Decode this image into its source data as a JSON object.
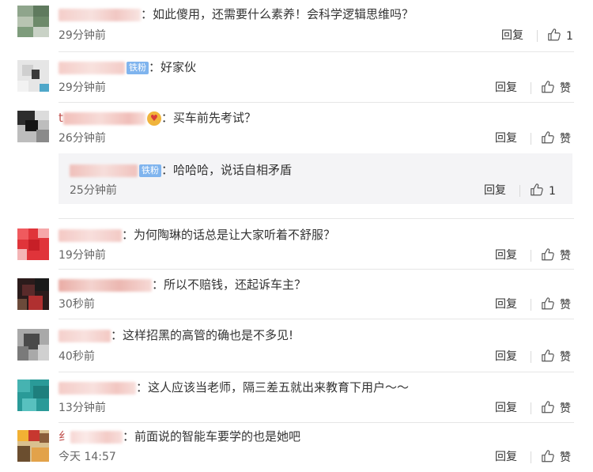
{
  "thumb_icon": "thumbs-up-icon",
  "badge_color": "#7fb4ee",
  "comments": [
    {
      "text": "：如此傻用，还需要什么素养！会科学逻辑思维吗？",
      "time": "29分钟前",
      "reply": "回复",
      "like": "1"
    },
    {
      "badge": "铁粉",
      "text": "：好家伙",
      "time": "29分钟前",
      "reply": "回复",
      "like": "赞"
    },
    {
      "name_prefix": "t",
      "text": "：买车前先考试？",
      "time": "26分钟前",
      "reply": "回复",
      "like": "赞",
      "sub": {
        "badge": "铁粉",
        "text": "：哈哈哈，说话自相矛盾",
        "time": "25分钟前",
        "reply": "回复",
        "like": "1"
      }
    },
    {
      "text": "：为何陶琳的话总是让大家听着不舒服？",
      "time": "19分钟前",
      "reply": "回复",
      "like": "赞"
    },
    {
      "text": "：所以不赔钱，还起诉车主？",
      "time": "30秒前",
      "reply": "回复",
      "like": "赞"
    },
    {
      "text": "：这样招黑的高管的确也是不多见!",
      "time": "40秒前",
      "reply": "回复",
      "like": "赞"
    },
    {
      "text": "：这人应该当老师，隔三差五就出来教育下用户～～",
      "time": "13分钟前",
      "reply": "回复",
      "like": "赞"
    },
    {
      "name_prefix": "纟",
      "text": "：前面说的智能车要学的也是她吧",
      "time": "今天 14:57",
      "reply": "回复",
      "like": "赞"
    }
  ]
}
